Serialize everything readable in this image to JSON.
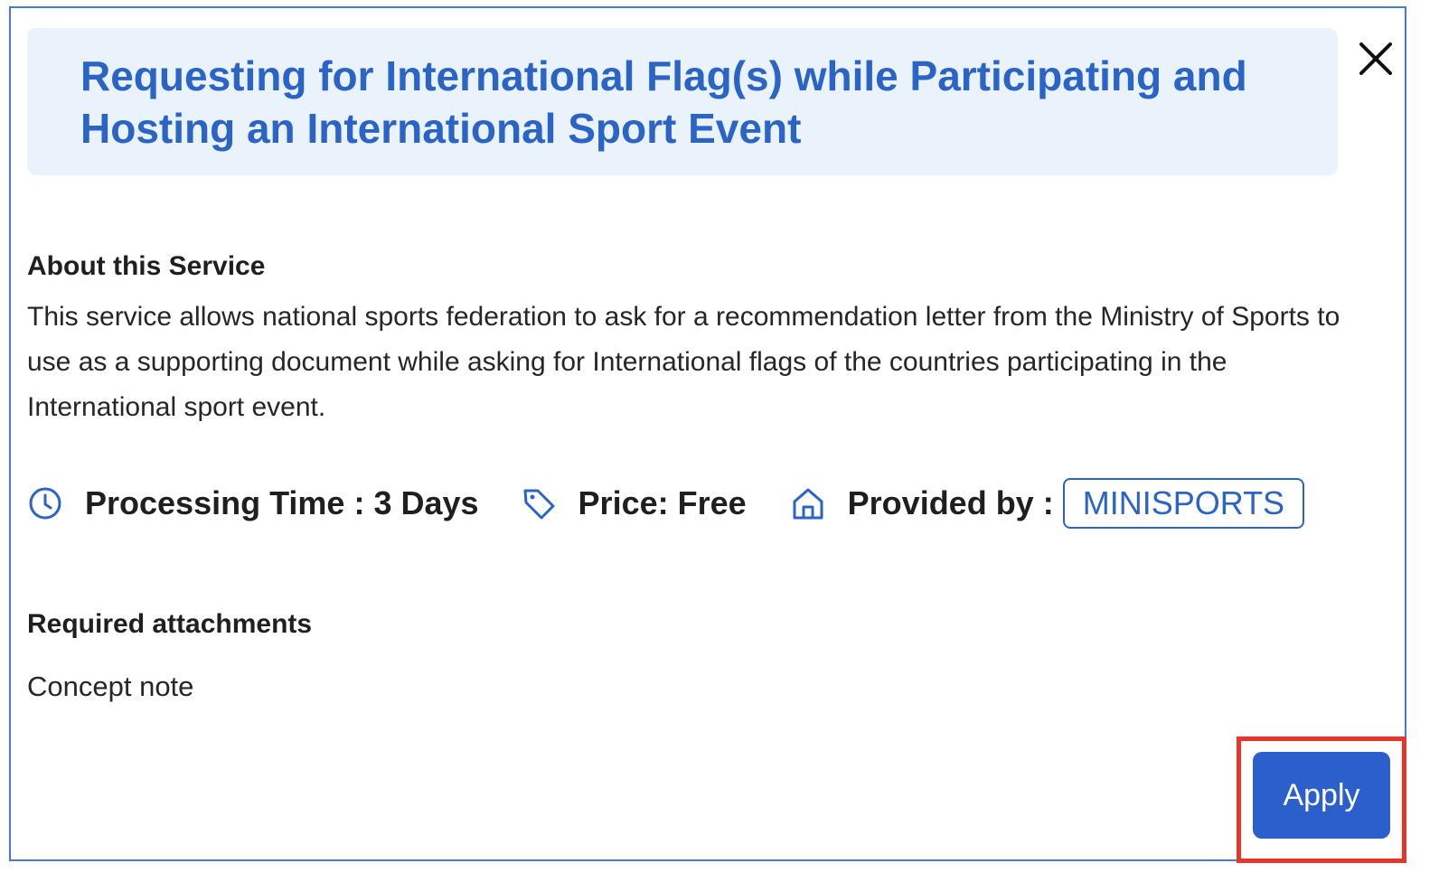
{
  "dialog": {
    "title": "Requesting for International Flag(s) while Participating and Hosting an International Sport Event",
    "close_icon": "close-icon"
  },
  "about": {
    "heading": "About this Service",
    "text": "This service allows national sports federation to ask for a recommendation letter from the Ministry of Sports to use as a supporting document while asking for International flags of the countries participating in the International sport event."
  },
  "meta": {
    "processing_time": "Processing Time : 3 Days",
    "price": "Price: Free",
    "provided_by_label": "Provided by :",
    "provider": "MINISPORTS",
    "icons": [
      "clock-icon",
      "tag-icon",
      "home-icon"
    ]
  },
  "attachments": {
    "heading": "Required attachments",
    "items": [
      "Concept note"
    ]
  },
  "actions": {
    "apply_label": "Apply"
  },
  "colors": {
    "accent": "#2b64c7",
    "title_bg": "#eaf2fb",
    "button_bg": "#2b5fcc",
    "highlight": "#e8352a",
    "border": "#4a78d0"
  }
}
